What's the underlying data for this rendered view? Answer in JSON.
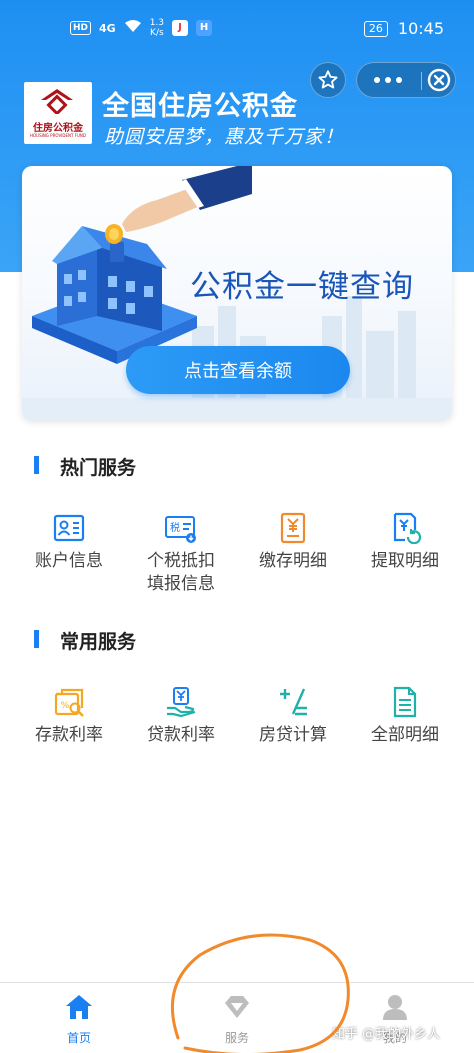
{
  "status_bar": {
    "hd": "HD",
    "signal": "4G",
    "speed_value": "1.3",
    "speed_unit": "K/s",
    "battery": "26",
    "time": "10:45"
  },
  "app": {
    "logo_text": "住房公积金",
    "logo_sub": "HOUSING PROVIDENT FUND",
    "title": "全国住房公积金",
    "slogan": "助圆安居梦，惠及千万家！"
  },
  "banner": {
    "title": "公积金一键查询",
    "button_label": "点击查看余额"
  },
  "hot_services": {
    "title": "热门服务",
    "items": [
      {
        "label": "账户信息",
        "icon": "id-card-icon"
      },
      {
        "label": "个税抵扣\n填报信息",
        "icon": "tax-icon",
        "icon_text": "税"
      },
      {
        "label": "缴存明细",
        "icon": "yuan-document-icon"
      },
      {
        "label": "提取明细",
        "icon": "yuan-refresh-icon"
      }
    ]
  },
  "common_services": {
    "title": "常用服务",
    "items": [
      {
        "label": "存款利率",
        "icon": "deposit-rate-icon"
      },
      {
        "label": "贷款利率",
        "icon": "loan-rate-icon"
      },
      {
        "label": "房贷计算",
        "icon": "calculator-icon"
      },
      {
        "label": "全部明细",
        "icon": "document-list-icon"
      }
    ]
  },
  "tabbar": {
    "items": [
      {
        "label": "首页",
        "icon": "home-icon",
        "active": true
      },
      {
        "label": "服务",
        "icon": "diamond-icon",
        "active": false
      },
      {
        "label": "我的",
        "icon": "user-icon",
        "active": false
      }
    ]
  },
  "watermark": "知乎 @我的外乡人",
  "colors": {
    "primary": "#1a7ff0",
    "header": "#2f9cf5",
    "orange_icon": "#f5a623",
    "teal_icon": "#20b2aa",
    "annotation": "#f08a2c"
  }
}
